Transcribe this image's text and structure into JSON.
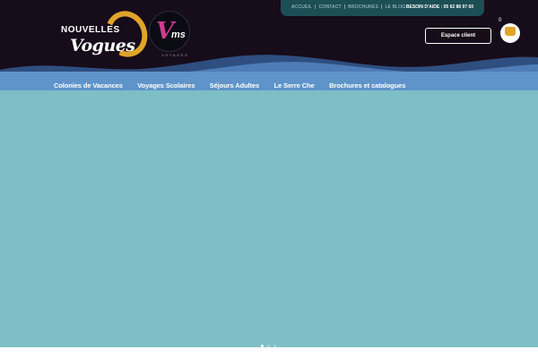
{
  "topbar": {
    "links": [
      "ACCUEIL",
      "CONTACT",
      "BROCHURES",
      "LE BLOG"
    ],
    "help": "BESOIN D'AIDE : 05 62 88 97 60"
  },
  "logos": {
    "nouvelles_vogues": {
      "line1": "NOUVELLES",
      "line2": "Vogues"
    },
    "vms": {
      "mark_v": "V",
      "mark_ms": "ms",
      "subtitle": "VOYAGES"
    }
  },
  "header": {
    "espace_client": "Espace client",
    "cart_count": "0"
  },
  "nav": {
    "items": [
      "Colonies de Vacances",
      "Voyages Scolaires",
      "Séjours Adultes",
      "Le Serre Che",
      "Brochures et catalogues"
    ]
  },
  "slider": {
    "slide_count": 3,
    "active_index": 0
  },
  "colors": {
    "header_bg": "#170c19",
    "nav_bg": "#5e94c9",
    "hero_bg": "#7ebfc6",
    "accent": "#e0a42a"
  }
}
